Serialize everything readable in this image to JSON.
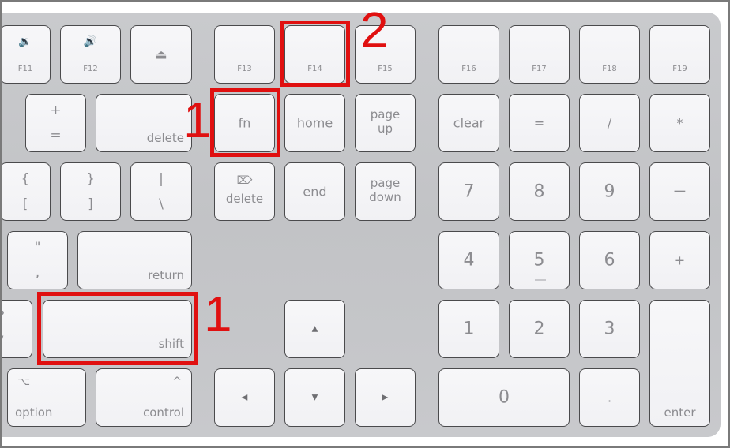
{
  "annotations": {
    "step1_fn": "1",
    "step2_f14": "2",
    "step1_shift": "1",
    "highlight_color": "#e01010"
  },
  "keys": {
    "f11": {
      "label": "F11",
      "icon": "🔉",
      "icon_name": "volume-down-icon"
    },
    "f12": {
      "label": "F12",
      "icon": "🔊",
      "icon_name": "volume-up-icon"
    },
    "eject": {
      "icon": "⏏",
      "icon_name": "eject-icon"
    },
    "f13": {
      "label": "F13"
    },
    "f14": {
      "label": "F14"
    },
    "f15": {
      "label": "F15"
    },
    "f16": {
      "label": "F16"
    },
    "f17": {
      "label": "F17"
    },
    "f18": {
      "label": "F18"
    },
    "f19": {
      "label": "F19"
    },
    "plus_equals": {
      "top": "+",
      "bottom": "="
    },
    "delete": {
      "label": "delete"
    },
    "fn": {
      "label": "fn"
    },
    "home": {
      "label": "home"
    },
    "page_up": {
      "top": "page",
      "bottom": "up"
    },
    "clear": {
      "label": "clear"
    },
    "np_equals": {
      "label": "="
    },
    "np_divide": {
      "label": "/"
    },
    "np_multiply": {
      "label": "*"
    },
    "brace_left": {
      "top": "{",
      "bottom": "["
    },
    "brace_right": {
      "top": "}",
      "bottom": "]"
    },
    "pipe": {
      "top": "|",
      "bottom": "\\"
    },
    "forward_delete": {
      "label": "delete",
      "icon": "⌦",
      "icon_name": "forward-delete-icon"
    },
    "end": {
      "label": "end"
    },
    "page_down": {
      "top": "page",
      "bottom": "down"
    },
    "np7": {
      "label": "7"
    },
    "np8": {
      "label": "8"
    },
    "np9": {
      "label": "9"
    },
    "np_minus": {
      "label": "−"
    },
    "quote": {
      "top": "\"",
      "bottom": ","
    },
    "return": {
      "label": "return"
    },
    "np4": {
      "label": "4"
    },
    "np5": {
      "label": "5"
    },
    "np6": {
      "label": "6"
    },
    "np_plus": {
      "label": "+"
    },
    "question": {
      "top": "?",
      "bottom": "/"
    },
    "shift": {
      "label": "shift"
    },
    "arrow_up": {
      "label": "▲"
    },
    "np1": {
      "label": "1"
    },
    "np2": {
      "label": "2"
    },
    "np3": {
      "label": "3"
    },
    "enter": {
      "label": "enter"
    },
    "option": {
      "label": "option",
      "icon": "⌥",
      "icon_name": "option-icon"
    },
    "control": {
      "label": "control",
      "icon": "^",
      "icon_name": "control-caret-icon"
    },
    "arrow_left": {
      "label": "◀"
    },
    "arrow_down": {
      "label": "▼"
    },
    "arrow_right": {
      "label": "▶"
    },
    "np0": {
      "label": "0"
    },
    "np_decimal": {
      "label": "."
    }
  }
}
